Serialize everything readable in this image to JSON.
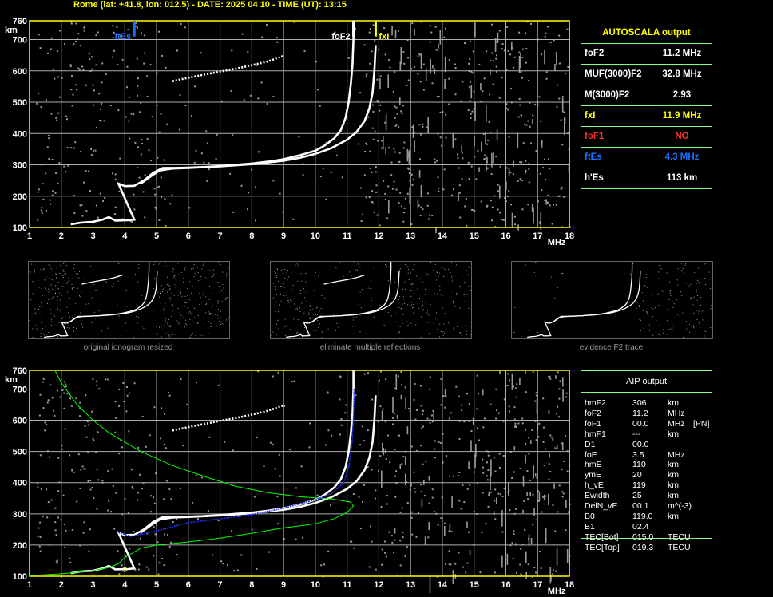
{
  "header": "Rome (lat: +41.8, lon: 012.5) - DATE: 2025 04 10 - TIME (UT): 13:15",
  "colors": {
    "grid": "#b0b0b0",
    "frame": "#ffff00",
    "trace": "#ffffff",
    "profile": "#00ff00",
    "model": "#2030ff",
    "ftEs": "#1e6fff",
    "fxI": "#ffff00",
    "foF1": "#ff3030"
  },
  "axes": {
    "y_unit": "km",
    "x_unit": "MHz",
    "y_ticks": [
      "100",
      "200",
      "300",
      "400",
      "500",
      "600",
      "700",
      "760"
    ],
    "x_ticks": [
      "1",
      "2",
      "3",
      "4",
      "5",
      "6",
      "7",
      "8",
      "9",
      "10",
      "11",
      "12",
      "13",
      "14",
      "15",
      "16",
      "17",
      "18"
    ],
    "xlim": [
      1,
      18
    ],
    "ylim": [
      100,
      760
    ]
  },
  "markers": {
    "ftEs": {
      "label": "ftEs",
      "freq": 4.3
    },
    "foF2": {
      "label": "foF2",
      "freq": 11.2
    },
    "fxI": {
      "label": "fxI",
      "freq": 11.9
    }
  },
  "chart_data": [
    {
      "type": "scatter",
      "series": [
        {
          "values": [
            [
              2.3,
              110
            ],
            [
              2.6,
              115
            ],
            [
              3.0,
              118
            ],
            [
              3.3,
              125
            ],
            [
              3.5,
              133
            ],
            [
              3.7,
              122
            ],
            [
              4.1,
              123
            ],
            [
              4.3,
              125
            ],
            [
              3.8,
              240
            ],
            [
              4.0,
              232
            ],
            [
              4.3,
              233
            ],
            [
              4.6,
              250
            ],
            [
              4.9,
              275
            ],
            [
              5.2,
              290
            ],
            [
              5.6,
              290
            ],
            [
              6.0,
              291
            ],
            [
              6.5,
              293
            ],
            [
              7.0,
              296
            ],
            [
              7.5,
              300
            ],
            [
              8.0,
              304
            ],
            [
              8.5,
              310
            ],
            [
              9.0,
              318
            ],
            [
              9.5,
              330
            ],
            [
              10.0,
              345
            ],
            [
              10.3,
              362
            ],
            [
              10.6,
              385
            ],
            [
              10.8,
              410
            ],
            [
              10.95,
              450
            ],
            [
              11.05,
              500
            ],
            [
              11.12,
              560
            ],
            [
              11.17,
              620
            ],
            [
              11.2,
              700
            ],
            [
              11.2,
              760
            ]
          ]
        },
        {
          "values": [
            [
              4.5,
              240
            ],
            [
              4.8,
              262
            ],
            [
              5.1,
              282
            ],
            [
              5.5,
              288
            ],
            [
              6.0,
              290
            ],
            [
              7.0,
              295
            ],
            [
              8.0,
              302
            ],
            [
              9.0,
              313
            ],
            [
              9.5,
              322
            ],
            [
              10.0,
              335
            ],
            [
              10.5,
              353
            ],
            [
              11.0,
              380
            ],
            [
              11.3,
              405
            ],
            [
              11.55,
              440
            ],
            [
              11.7,
              480
            ],
            [
              11.8,
              530
            ],
            [
              11.86,
              600
            ],
            [
              11.9,
              680
            ]
          ]
        },
        {
          "values": [
            [
              5.5,
              567
            ],
            [
              6.0,
              578
            ],
            [
              6.5,
              588
            ],
            [
              7.0,
              598
            ],
            [
              7.5,
              607
            ],
            [
              8.0,
              618
            ],
            [
              8.5,
              630
            ],
            [
              9.0,
              648
            ]
          ]
        }
      ]
    },
    {
      "type": "line",
      "series": [
        {
          "values": [
            [
              1.0,
              102
            ],
            [
              2.0,
              108
            ],
            [
              3.0,
              118
            ],
            [
              3.5,
              128
            ],
            [
              3.8,
              140
            ],
            [
              4.0,
              160
            ],
            [
              4.5,
              190
            ],
            [
              5.0,
              200
            ],
            [
              6.0,
              210
            ],
            [
              7.0,
              222
            ],
            [
              8.0,
              238
            ],
            [
              9.0,
              255
            ],
            [
              10.0,
              268
            ],
            [
              10.6,
              285
            ],
            [
              11.0,
              305
            ],
            [
              11.2,
              325
            ],
            [
              11.1,
              338
            ],
            [
              10.5,
              348
            ],
            [
              9.5,
              355
            ],
            [
              8.5,
              368
            ],
            [
              7.5,
              388
            ],
            [
              6.5,
              420
            ],
            [
              5.5,
              455
            ],
            [
              4.5,
              500
            ],
            [
              3.5,
              560
            ],
            [
              3.0,
              600
            ],
            [
              2.5,
              650
            ],
            [
              2.0,
              720
            ],
            [
              1.8,
              760
            ]
          ]
        },
        {
          "values": [
            [
              3.8,
              240
            ],
            [
              4.2,
              228
            ],
            [
              5.0,
              245
            ],
            [
              6.0,
              272
            ],
            [
              7.0,
              284
            ],
            [
              8.0,
              298
            ],
            [
              9.0,
              318
            ],
            [
              10.0,
              345
            ],
            [
              10.5,
              365
            ],
            [
              10.9,
              400
            ],
            [
              11.05,
              450
            ],
            [
              11.15,
              520
            ],
            [
              11.2,
              600
            ],
            [
              11.22,
              700
            ]
          ]
        }
      ]
    }
  ],
  "autoscala": {
    "title": "AUTOSCALA output",
    "rows": [
      {
        "key": "foF2",
        "value": "11.2 MHz",
        "color": "#ffffff",
        "vcolor": "#ffffff"
      },
      {
        "key": "MUF(3000)F2",
        "value": "32.8 MHz",
        "color": "#ffffff",
        "vcolor": "#ffffff"
      },
      {
        "key": "M(3000)F2",
        "value": "2.93",
        "color": "#ffffff",
        "vcolor": "#ffffff"
      },
      {
        "key": "fxI",
        "value": "11.9 MHz",
        "color": "#ffff00",
        "vcolor": "#ffff00"
      },
      {
        "key": "foF1",
        "value": "NO",
        "color": "#ff3030",
        "vcolor": "#ff3030"
      },
      {
        "key": "ftEs",
        "value": "4.3 MHz",
        "color": "#1e6fff",
        "vcolor": "#1e6fff"
      },
      {
        "key": "h'Es",
        "value": "113    km",
        "color": "#ffffff",
        "vcolor": "#ffffff"
      }
    ]
  },
  "aip": {
    "title": "AIP output",
    "rows": [
      {
        "k": "hmF2",
        "v": "306",
        "u": "km",
        "x": ""
      },
      {
        "k": "foF2",
        "v": "11.2",
        "u": "MHz",
        "x": ""
      },
      {
        "k": "foF1",
        "v": "00.0",
        "u": "MHz",
        "x": "[PN]"
      },
      {
        "k": "hmF1",
        "v": "---",
        "u": "km",
        "x": ""
      },
      {
        "k": "D1",
        "v": "00.0",
        "u": "",
        "x": ""
      },
      {
        "k": "foE",
        "v": "3.5",
        "u": "MHz",
        "x": ""
      },
      {
        "k": "hmE",
        "v": "110",
        "u": "km",
        "x": ""
      },
      {
        "k": "ymE",
        "v": "20",
        "u": "km",
        "x": ""
      },
      {
        "k": "h_vE",
        "v": "119",
        "u": "km",
        "x": ""
      },
      {
        "k": "Ewidth",
        "v": "25",
        "u": "km",
        "x": ""
      },
      {
        "k": "DelN_vE",
        "v": "00.1",
        "u": "m^(-3)",
        "x": ""
      },
      {
        "k": "B0",
        "v": "119.0",
        "u": "km",
        "x": ""
      },
      {
        "k": "B1",
        "v": "02.4",
        "u": "",
        "x": ""
      },
      {
        "k": "TEC[Bot]",
        "v": "015.0",
        "u": "TECU",
        "x": ""
      },
      {
        "k": "TEC[Top]",
        "v": "019.3",
        "u": "TECU",
        "x": ""
      }
    ]
  },
  "thumbnails": [
    {
      "caption": "original ionogram resized"
    },
    {
      "caption": "eliminate multiple reflections"
    },
    {
      "caption": "evidence F2 trace"
    }
  ]
}
